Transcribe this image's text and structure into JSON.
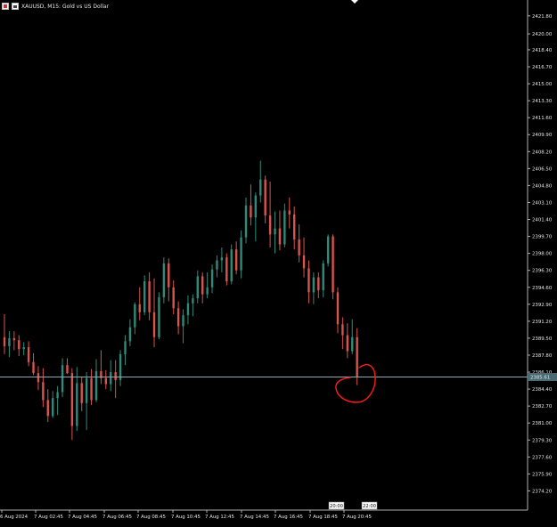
{
  "header": {
    "title": "XAUUSD, M15:  Gold vs US Dollar"
  },
  "colors": {
    "background": "#000000",
    "bull": "#2e8b7a",
    "bear": "#d9534f",
    "axis_text": "#e6e6e6",
    "price_line": "#8fa9b5",
    "price_tag_bg": "#4a6b73",
    "annotation": "#ff1a1a"
  },
  "current_price": {
    "label": "2385.61",
    "value": 2385.61
  },
  "x_badges": [
    "20:00",
    "22:00"
  ],
  "chart_data": {
    "type": "candlestick",
    "title": "XAUUSD, M15:  Gold vs US Dollar",
    "ylim": [
      2372.9,
      2422.5
    ],
    "y_ticks": [
      "2421.80",
      "2420.00",
      "2418.40",
      "2416.70",
      "2415.00",
      "2413.30",
      "2411.60",
      "2409.90",
      "2408.20",
      "2406.50",
      "2404.80",
      "2403.10",
      "2401.40",
      "2399.70",
      "2398.00",
      "2396.30",
      "2394.60",
      "2392.90",
      "2391.20",
      "2389.50",
      "2387.80",
      "2386.10",
      "2384.40",
      "2382.70",
      "2381.00",
      "2379.30",
      "2377.60",
      "2375.90",
      "2374.20"
    ],
    "x_labels": [
      "6 Aug 2024",
      "7 Aug 02:45",
      "7 Aug 04:45",
      "7 Aug 06:45",
      "7 Aug 08:45",
      "7 Aug 10:45",
      "7 Aug 12:45",
      "7 Aug 14:45",
      "7 Aug 16:45",
      "7 Aug 18:45",
      "7 Aug 20:45"
    ],
    "ohlc": [
      [
        2389.6,
        2391.9,
        2387.9,
        2388.7
      ],
      [
        2388.7,
        2390.2,
        2387.6,
        2389.5
      ],
      [
        2389.5,
        2390.2,
        2388.3,
        2389.3
      ],
      [
        2389.3,
        2389.8,
        2387.7,
        2388.4
      ],
      [
        2388.4,
        2389.1,
        2387.8,
        2388.6
      ],
      [
        2388.6,
        2389.2,
        2386.7,
        2387.1
      ],
      [
        2387.1,
        2388.0,
        2385.8,
        2386.0
      ],
      [
        2386.0,
        2386.7,
        2384.3,
        2385.1
      ],
      [
        2385.1,
        2386.5,
        2382.6,
        2383.3
      ],
      [
        2383.3,
        2384.4,
        2381.1,
        2381.7
      ],
      [
        2381.7,
        2384.2,
        2381.5,
        2383.5
      ],
      [
        2383.5,
        2384.7,
        2381.8,
        2384.1
      ],
      [
        2384.1,
        2387.5,
        2383.6,
        2386.8
      ],
      [
        2386.8,
        2387.5,
        2385.9,
        2386.0
      ],
      [
        2386.0,
        2386.5,
        2379.3,
        2380.7
      ],
      [
        2380.7,
        2386.6,
        2380.2,
        2385.0
      ],
      [
        2385.0,
        2385.6,
        2382.2,
        2383.0
      ],
      [
        2383.0,
        2386.1,
        2380.3,
        2385.5
      ],
      [
        2385.5,
        2386.4,
        2382.8,
        2383.3
      ],
      [
        2383.3,
        2387.4,
        2383.1,
        2386.2
      ],
      [
        2386.2,
        2388.3,
        2384.9,
        2385.5
      ],
      [
        2385.5,
        2386.3,
        2384.4,
        2384.9
      ],
      [
        2384.9,
        2387.3,
        2384.2,
        2386.1
      ],
      [
        2386.1,
        2387.3,
        2383.5,
        2385.3
      ],
      [
        2385.3,
        2388.3,
        2384.7,
        2387.9
      ],
      [
        2387.9,
        2389.8,
        2386.8,
        2389.2
      ],
      [
        2389.2,
        2391.4,
        2388.7,
        2390.6
      ],
      [
        2390.6,
        2393.1,
        2389.9,
        2392.9
      ],
      [
        2392.9,
        2394.6,
        2391.3,
        2392.1
      ],
      [
        2392.1,
        2395.8,
        2391.8,
        2395.2
      ],
      [
        2395.2,
        2396.1,
        2391.3,
        2392.1
      ],
      [
        2392.1,
        2395.5,
        2388.6,
        2389.6
      ],
      [
        2389.6,
        2394.1,
        2389.4,
        2393.6
      ],
      [
        2393.6,
        2397.6,
        2393.0,
        2397.0
      ],
      [
        2397.0,
        2397.5,
        2393.2,
        2394.6
      ],
      [
        2394.6,
        2395.3,
        2391.9,
        2392.5
      ],
      [
        2392.5,
        2393.2,
        2389.9,
        2390.7
      ],
      [
        2390.7,
        2392.4,
        2389.0,
        2391.8
      ],
      [
        2391.8,
        2393.8,
        2390.9,
        2393.0
      ],
      [
        2393.0,
        2393.9,
        2391.7,
        2393.5
      ],
      [
        2393.5,
        2396.3,
        2393.0,
        2395.7
      ],
      [
        2395.7,
        2396.1,
        2393.0,
        2393.9
      ],
      [
        2393.9,
        2396.1,
        2393.5,
        2394.6
      ],
      [
        2394.6,
        2396.9,
        2394.0,
        2396.4
      ],
      [
        2396.4,
        2397.8,
        2395.6,
        2397.3
      ],
      [
        2397.3,
        2398.6,
        2396.1,
        2397.6
      ],
      [
        2397.6,
        2398.0,
        2394.8,
        2395.2
      ],
      [
        2395.2,
        2398.9,
        2394.9,
        2398.4
      ],
      [
        2398.4,
        2399.2,
        2395.9,
        2396.3
      ],
      [
        2396.3,
        2400.3,
        2395.5,
        2399.6
      ],
      [
        2399.6,
        2403.6,
        2399.0,
        2402.8
      ],
      [
        2402.8,
        2404.9,
        2400.8,
        2401.6
      ],
      [
        2401.6,
        2404.1,
        2399.2,
        2403.8
      ],
      [
        2403.8,
        2407.3,
        2403.1,
        2405.4
      ],
      [
        2405.4,
        2405.8,
        2401.0,
        2401.8
      ],
      [
        2401.8,
        2405.2,
        2398.6,
        2399.9
      ],
      [
        2399.9,
        2402.2,
        2398.0,
        2400.5
      ],
      [
        2400.5,
        2402.3,
        2398.3,
        2398.9
      ],
      [
        2398.9,
        2403.0,
        2398.6,
        2402.3
      ],
      [
        2402.3,
        2403.6,
        2400.5,
        2401.9
      ],
      [
        2401.9,
        2402.7,
        2398.4,
        2399.4
      ],
      [
        2399.4,
        2400.9,
        2397.1,
        2397.8
      ],
      [
        2397.8,
        2399.6,
        2395.6,
        2396.5
      ],
      [
        2396.5,
        2397.3,
        2393.0,
        2394.1
      ],
      [
        2394.1,
        2396.1,
        2392.9,
        2395.6
      ],
      [
        2395.6,
        2396.1,
        2393.5,
        2394.3
      ],
      [
        2394.3,
        2397.3,
        2393.6,
        2397.0
      ],
      [
        2397.0,
        2399.9,
        2396.7,
        2399.7
      ],
      [
        2399.7,
        2399.9,
        2393.4,
        2394.1
      ],
      [
        2394.1,
        2394.6,
        2390.0,
        2390.9
      ],
      [
        2390.9,
        2391.6,
        2388.4,
        2389.8
      ],
      [
        2389.8,
        2391.0,
        2387.5,
        2388.2
      ],
      [
        2388.2,
        2391.4,
        2387.9,
        2389.6
      ],
      [
        2389.6,
        2390.5,
        2384.8,
        2385.6
      ]
    ]
  }
}
